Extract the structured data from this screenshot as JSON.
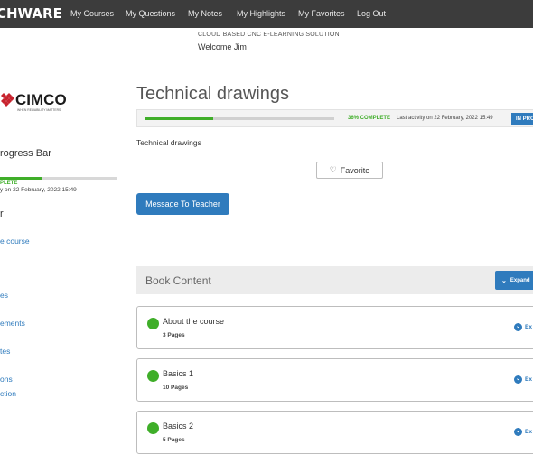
{
  "nav": {
    "brand": "CHWARE",
    "links": [
      "My Courses",
      "My Questions",
      "My Notes",
      "My Highlights",
      "My Favorites",
      "Log Out"
    ]
  },
  "header": {
    "tagline": "CLOUD BASED CNC E-LEARNING SOLUTION",
    "welcome": "Welcome Jim"
  },
  "sidebar": {
    "logo_text": "CIMCO",
    "logo_tagline": "WHEN RELIABILITY MATTERS",
    "progress_heading": "rogress Bar",
    "progress_fraction": 0.36,
    "complete_label": "PLETE",
    "last_activity": "y on 22 February, 2022 15:49",
    "section_heading": "r",
    "links": [
      "e course",
      "es",
      "ements",
      "tes",
      "ons",
      "ction"
    ]
  },
  "main": {
    "title": "Technical drawings",
    "progress": {
      "fraction": 0.36,
      "complete_label": "36% COMPLETE",
      "last_activity": "Last activity on 22 February, 2022 15:49",
      "status": "IN PRO"
    },
    "subtitle": "Technical drawings",
    "favorite_label": "Favorite",
    "message_label": "Message To Teacher"
  },
  "book": {
    "title": "Book Content",
    "expand_all_label": "Expand",
    "chapters": [
      {
        "title": "About the course",
        "pages": "3 Pages",
        "expand": "Ex"
      },
      {
        "title": "Basics 1",
        "pages": "10 Pages",
        "expand": "Ex"
      },
      {
        "title": "Basics 2",
        "pages": "5 Pages",
        "expand": "Ex"
      }
    ]
  },
  "colors": {
    "nav_bg": "#3c3c3c",
    "accent_blue": "#2f7bbd",
    "progress_green": "#3fae29"
  }
}
